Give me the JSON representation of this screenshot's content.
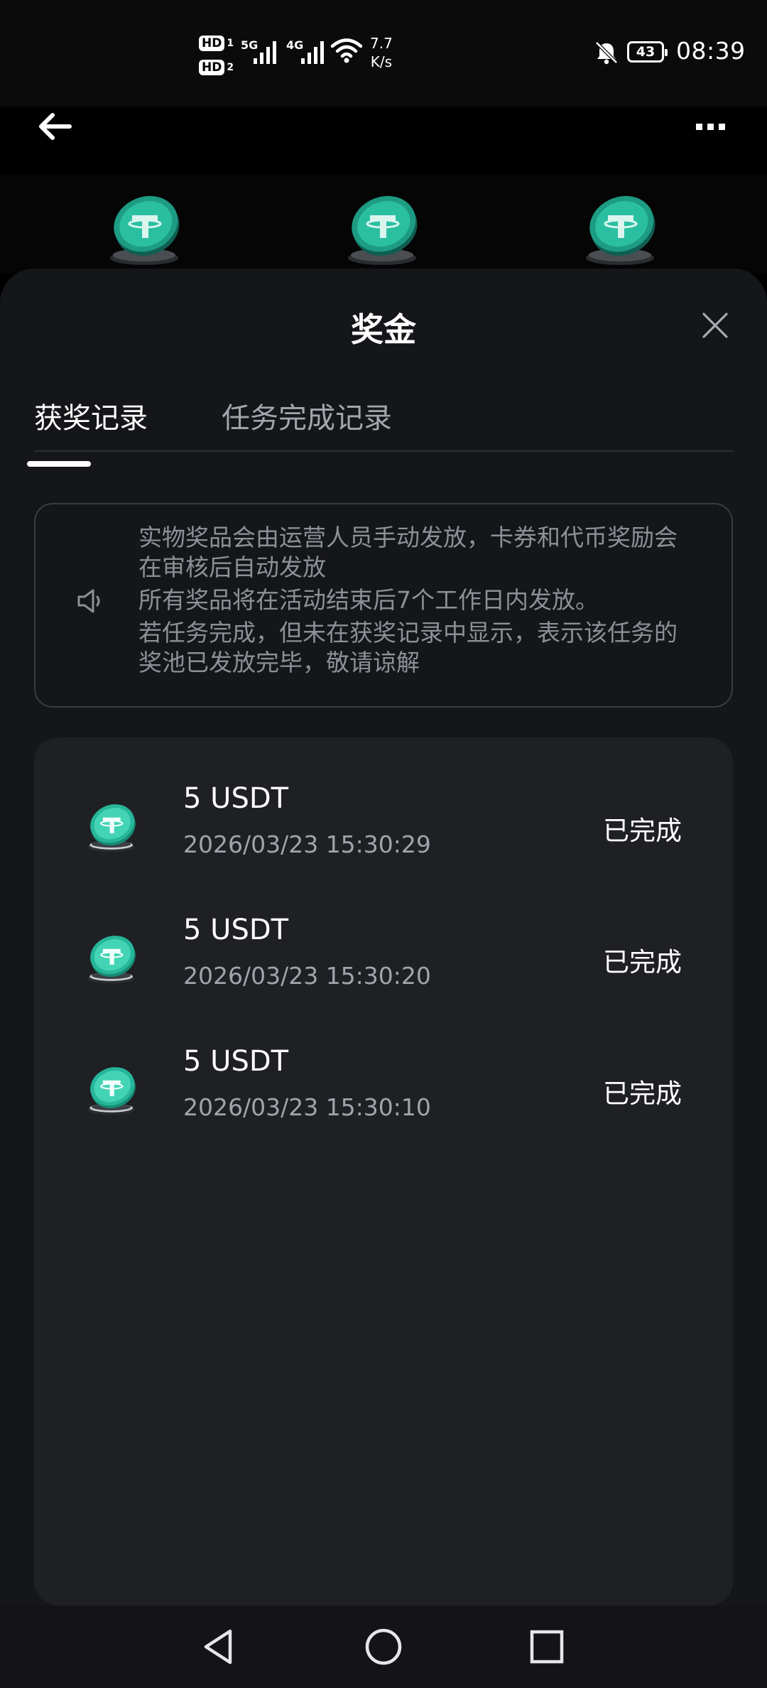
{
  "status_bar": {
    "sim1_badge": "HD",
    "sim1_number": "1",
    "sim2_badge": "HD",
    "sim2_number": "2",
    "network_1": "5G",
    "network_2": "4G",
    "net_speed_value": "7.7",
    "net_speed_unit": "K/s",
    "battery_level": "43",
    "time": "08:39",
    "icons": [
      "signal-icon",
      "wifi-icon",
      "bell-off-icon",
      "battery-icon"
    ]
  },
  "app_bar": {
    "back_icon": "arrow-left-icon",
    "more_icon": "more-icon"
  },
  "sheet": {
    "title": "奖金",
    "close_icon": "close-icon",
    "tabs": [
      {
        "label": "获奖记录",
        "active": true
      },
      {
        "label": "任务完成记录",
        "active": false
      }
    ],
    "notice": {
      "icon": "speaker-icon",
      "lines": [
        "实物奖品会由运营人员手动发放，卡券和代币奖励会在审核后自动发放",
        "所有奖品将在活动结束后7个工作日内发放。",
        "若任务完成，但未在获奖记录中显示，表示该任务的奖池已发放完毕，敬请谅解"
      ]
    },
    "records": [
      {
        "icon": "usdt-coin-icon",
        "amount": "5 USDT",
        "time": "2026/03/23 15:30:29",
        "status": "已完成"
      },
      {
        "icon": "usdt-coin-icon",
        "amount": "5 USDT",
        "time": "2026/03/23 15:30:20",
        "status": "已完成"
      },
      {
        "icon": "usdt-coin-icon",
        "amount": "5 USDT",
        "time": "2026/03/23 15:30:10",
        "status": "已完成"
      }
    ]
  },
  "nav_bar": {
    "buttons": [
      "back-triangle-icon",
      "home-circle-icon",
      "recents-square-icon"
    ]
  },
  "colors": {
    "sheet_background": "#151619",
    "card_background": "#1f2024",
    "notice_text": "#8c9097",
    "coin_teal": "#2bbfa2"
  }
}
